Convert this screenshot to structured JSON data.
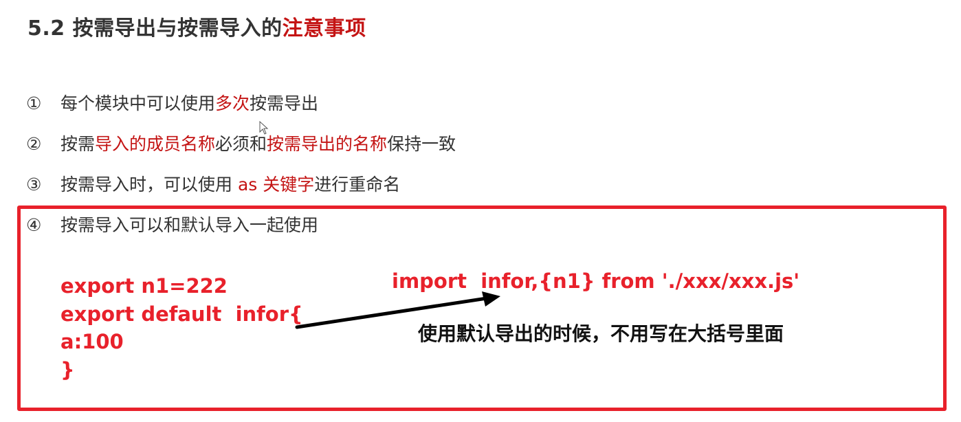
{
  "title": {
    "prefix": "5.2 按需导出与按需导入的",
    "highlight": "注意事项"
  },
  "items": [
    {
      "num": "①",
      "parts": [
        "每个模块中可以使用",
        "多次",
        "按需导出"
      ]
    },
    {
      "num": "②",
      "parts": [
        "按需",
        "导入的成员名称",
        "必须和",
        "按需导出的名称",
        "保持一致"
      ]
    },
    {
      "num": "③",
      "parts": [
        "按需导入时，可以使用 ",
        "as 关键字",
        "进行重命名"
      ]
    },
    {
      "num": "④",
      "parts": [
        "按需导入可以和默认导入一起使用"
      ]
    }
  ],
  "code": {
    "lines": [
      "export n1=222",
      "export default  infor{",
      "a:100",
      "}"
    ],
    "import": "import  infor,{n1} from './xxx/xxx.js'",
    "note": "使用默认导出的时候，不用写在大括号里面"
  },
  "colors": {
    "accent_red": "#c41414",
    "box_red": "#e8212b",
    "text": "#333333"
  }
}
